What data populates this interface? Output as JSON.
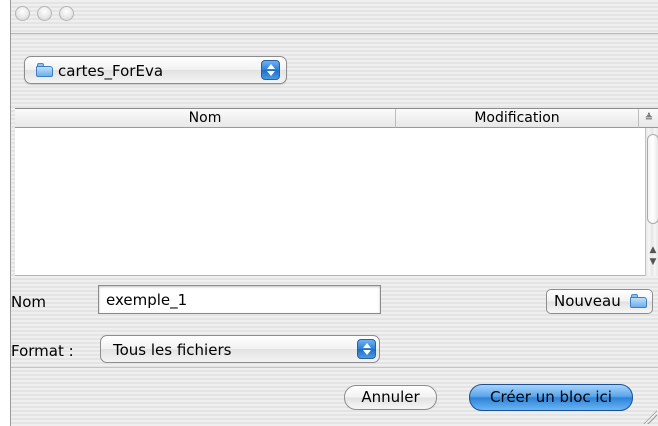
{
  "location": {
    "folder_name": "cartes_ForEva"
  },
  "file_list": {
    "columns": [
      "Nom",
      "Modification"
    ]
  },
  "name_field": {
    "label": "Nom",
    "value": "exemple_1"
  },
  "new_folder_button": {
    "label": "Nouveau"
  },
  "format": {
    "label": "Format :",
    "selected": "Tous les fichiers"
  },
  "actions": {
    "cancel_label": "Annuler",
    "create_label": "Créer un bloc ici"
  }
}
